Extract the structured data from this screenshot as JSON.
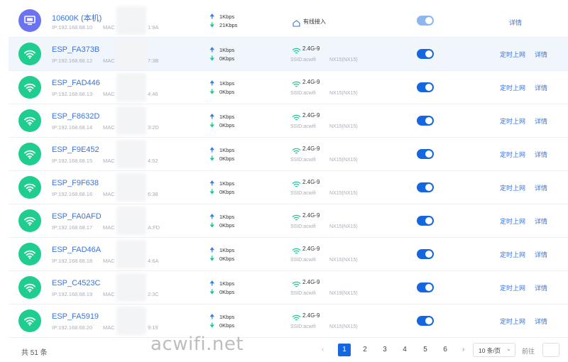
{
  "devices": [
    {
      "name": "10600K (本机)",
      "ip": "IP:192.168.68.10",
      "mac_label": "MAC",
      "mac_tail": "1:9A",
      "up": "1Kbps",
      "down": "21Kbps",
      "type": "pc",
      "conn": "有线接入",
      "sched": "",
      "detail": "详情",
      "toggle": "light"
    },
    {
      "name": "ESP_FA373B",
      "ip": "IP:192.168.68.12",
      "mac_label": "MAC",
      "mac_tail": "7:3B",
      "up": "1Kbps",
      "down": "0Kbps",
      "type": "wifi",
      "band": "2.4G-9",
      "ssid": "SSID:acwifi",
      "model": "NX15(NX15)",
      "sched": "定时上网",
      "detail": "详情",
      "toggle": "on"
    },
    {
      "name": "ESP_FAD446",
      "ip": "IP:192.168.68.13",
      "mac_label": "MAC",
      "mac_tail": "4:46",
      "up": "1Kbps",
      "down": "0Kbps",
      "type": "wifi",
      "band": "2.4G-9",
      "ssid": "SSID:acwifi",
      "model": "NX15(NX15)",
      "sched": "定时上网",
      "detail": "详情",
      "toggle": "on"
    },
    {
      "name": "ESP_F8632D",
      "ip": "IP:192.168.68.14",
      "mac_label": "MAC",
      "mac_tail": "3:2D",
      "up": "1Kbps",
      "down": "0Kbps",
      "type": "wifi",
      "band": "2.4G-9",
      "ssid": "SSID:acwifi",
      "model": "NX15(NX15)",
      "sched": "定时上网",
      "detail": "详情",
      "toggle": "on"
    },
    {
      "name": "ESP_F9E452",
      "ip": "IP:192.168.68.15",
      "mac_label": "MAC",
      "mac_tail": "4:52",
      "up": "1Kbps",
      "down": "0Kbps",
      "type": "wifi",
      "band": "2.4G-9",
      "ssid": "SSID:acwifi",
      "model": "NX15(NX15)",
      "sched": "定时上网",
      "detail": "详情",
      "toggle": "on"
    },
    {
      "name": "ESP_F9F638",
      "ip": "IP:192.168.68.16",
      "mac_label": "MAC",
      "mac_tail": "6:38",
      "up": "1Kbps",
      "down": "0Kbps",
      "type": "wifi",
      "band": "2.4G-9",
      "ssid": "SSID:acwifi",
      "model": "NX15(NX15)",
      "sched": "定时上网",
      "detail": "详情",
      "toggle": "on"
    },
    {
      "name": "ESP_FA0AFD",
      "ip": "IP:192.168.68.17",
      "mac_label": "MAC",
      "mac_tail": "A:FD",
      "up": "1Kbps",
      "down": "0Kbps",
      "type": "wifi",
      "band": "2.4G-9",
      "ssid": "SSID:acwifi",
      "model": "NX15(NX15)",
      "sched": "定时上网",
      "detail": "详情",
      "toggle": "on"
    },
    {
      "name": "ESP_FAD46A",
      "ip": "IP:192.168.68.18",
      "mac_label": "MAC",
      "mac_tail": "4:6A",
      "up": "1Kbps",
      "down": "0Kbps",
      "type": "wifi",
      "band": "2.4G-9",
      "ssid": "SSID:acwifi",
      "model": "NX15(NX15)",
      "sched": "定时上网",
      "detail": "详情",
      "toggle": "on"
    },
    {
      "name": "ESP_C4523C",
      "ip": "IP:192.168.68.19",
      "mac_label": "MAC",
      "mac_tail": "2:3C",
      "up": "1Kbps",
      "down": "0Kbps",
      "type": "wifi",
      "band": "2.4G-9",
      "ssid": "SSID:acwifi",
      "model": "NX19(NX15)",
      "sched": "定时上网",
      "detail": "详情",
      "toggle": "on"
    },
    {
      "name": "ESP_FA5919",
      "ip": "IP:192.168.68.20",
      "mac_label": "MAC",
      "mac_tail": "9:19",
      "up": "1Kbps",
      "down": "0Kbps",
      "type": "wifi",
      "band": "2.4G-9",
      "ssid": "SSID:acwifi",
      "model": "NX15(NX15)",
      "sched": "定时上网",
      "detail": "详情",
      "toggle": "on"
    }
  ],
  "footer": {
    "total": "共 51 条",
    "watermark": "acwifi.net",
    "prev": "‹",
    "next": "›",
    "pages": [
      "1",
      "2",
      "3",
      "4",
      "5",
      "6"
    ],
    "active_page": "1",
    "page_size": "10 条/页",
    "goto_label": "前往"
  },
  "colors": {
    "accent": "#1467e0",
    "link": "#3a73d8",
    "wifi_icon_bg": "#1fcd8f",
    "pc_icon_bg": "#6b73f3",
    "row_highlight": "#f1f5fc"
  },
  "icons": {
    "wifi_device": "wifi-icon",
    "pc_device": "monitor-icon",
    "upload": "arrow-up-icon",
    "download": "arrow-down-icon",
    "wifi_band": "wifi-signal-icon",
    "wired": "home-icon"
  }
}
